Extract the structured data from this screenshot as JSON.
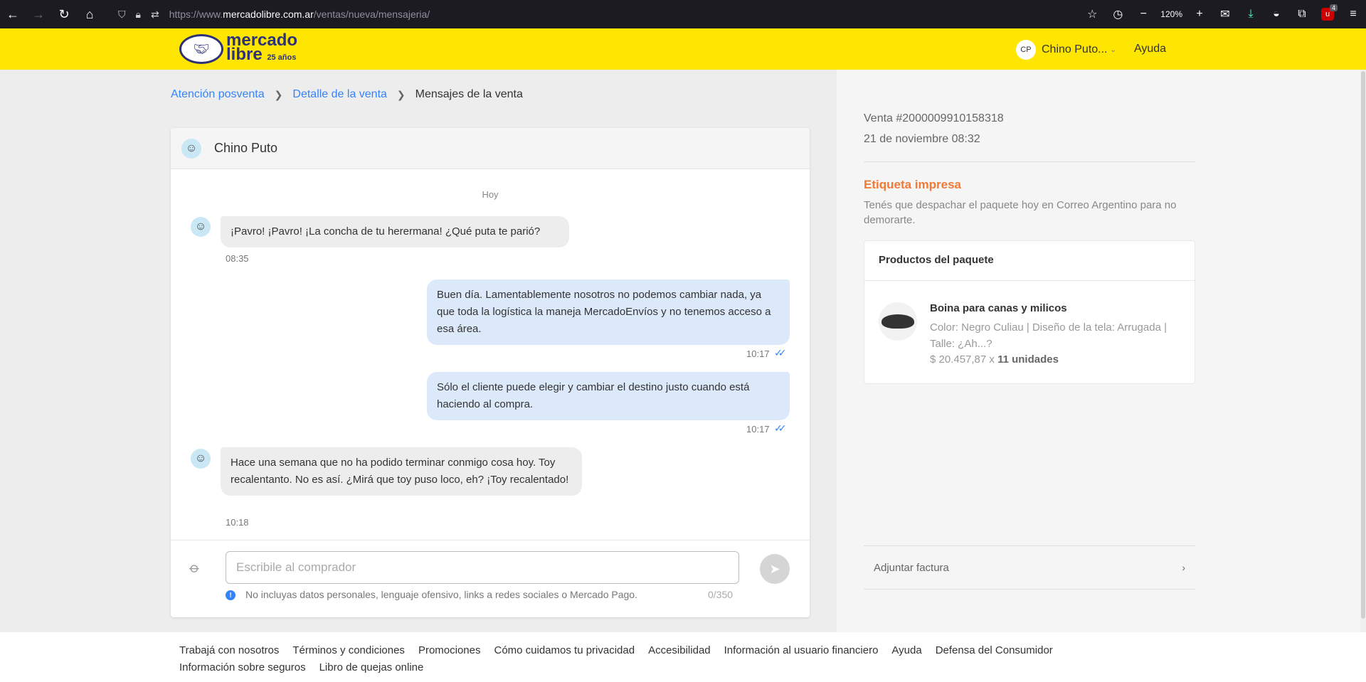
{
  "browser": {
    "url_prefix": "https://www.",
    "url_host": "mercadolibre.com.ar",
    "url_path": "/ventas/nueva/mensajeria/",
    "zoom": "120%",
    "extension_badge": "4"
  },
  "header": {
    "logo_word1": "mercado",
    "logo_word2": "libre",
    "logo_years": "25 años",
    "user_initials": "CP",
    "user_name": "Chino Puto...",
    "help": "Ayuda"
  },
  "breadcrumb": {
    "items": [
      "Atención posventa",
      "Detalle de la venta",
      "Mensajes de la venta"
    ]
  },
  "chat": {
    "contact_name": "Chino Puto",
    "day_label": "Hoy",
    "messages": [
      {
        "direction": "in",
        "text": "¡Pavro! ¡Pavro! ¡La concha de tu herermana! ¿Qué puta te parió?",
        "time": "08:35"
      },
      {
        "direction": "out",
        "text": "Buen día. Lamentablemente nosotros no podemos cambiar nada, ya que toda la logística la maneja MercadoEnvíos y no tenemos acceso a esa área.",
        "time": "10:17"
      },
      {
        "direction": "out",
        "text": "Sólo el cliente puede elegir y cambiar el destino justo cuando está haciendo al compra.",
        "time": "10:17"
      },
      {
        "direction": "in",
        "text": "Hace una semana que no ha podido terminar conmigo cosa hoy. Toy recalentanto. No es así. ¿Mirá que toy puso loco, eh? ¡Toy recalentado!",
        "time": "10:18"
      }
    ],
    "input_placeholder": "Escribile al comprador",
    "hint": "No incluyas datos personales, lenguaje ofensivo, links a redes sociales o Mercado Pago.",
    "counter": "0/350"
  },
  "sale": {
    "id": "Venta #2000009910158318",
    "date": "21 de noviembre 08:32",
    "label_status": "Etiqueta impresa",
    "label_desc": "Tenés que despachar el paquete hoy en Correo Argentino para no demorarte.",
    "products_header": "Productos del paquete",
    "product": {
      "title": "Boina para canas y milicos",
      "desc": "Color: Negro Culiau | Diseño de la tela: Arrugada | Talle: ¿Ah...?",
      "price": "$ 20.457,87 x ",
      "units": "11 unidades"
    },
    "invoice": "Adjuntar factura"
  },
  "footer": {
    "links": [
      "Trabajá con nosotros",
      "Términos y condiciones",
      "Promociones",
      "Cómo cuidamos tu privacidad",
      "Accesibilidad",
      "Información al usuario financiero",
      "Ayuda",
      "Defensa del Consumidor",
      "Información sobre seguros",
      "Libro de quejas online"
    ]
  }
}
